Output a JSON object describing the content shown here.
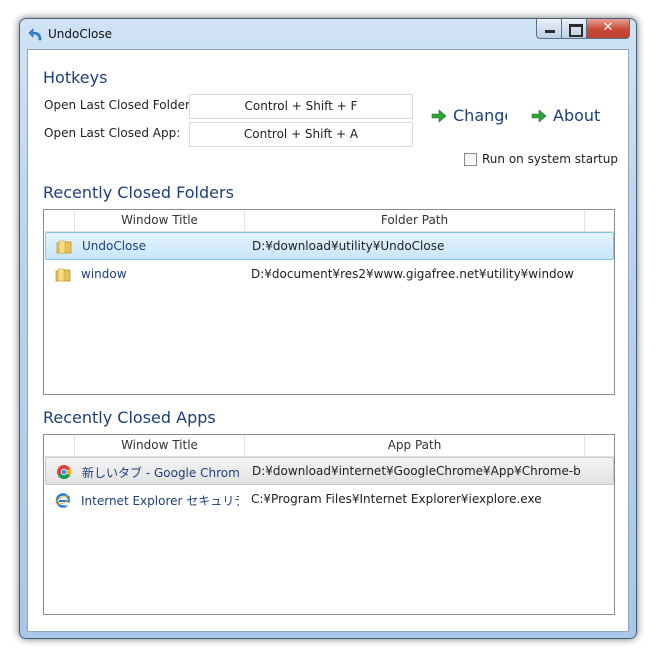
{
  "window": {
    "title": "UndoClose"
  },
  "hotkeys": {
    "heading": "Hotkeys",
    "folder_label": "Open Last Closed Folder:",
    "folder_value": "Control + Shift + F",
    "app_label": "Open Last Closed App:",
    "app_value": "Control + Shift + A",
    "change_label": "Change",
    "about_label": "About",
    "startup_label": "Run on system startup",
    "startup_checked": false
  },
  "folders": {
    "heading": "Recently Closed Folders",
    "columns": [
      "Window Title",
      "Folder Path"
    ],
    "rows": [
      {
        "icon": "folder-icon",
        "title": "UndoClose",
        "path": "D:¥download¥utility¥UndoClose",
        "selected": true
      },
      {
        "icon": "folder-icon",
        "title": "window",
        "path": "D:¥document¥res2¥www.gigafree.net¥utility¥window",
        "selected": false
      }
    ]
  },
  "apps": {
    "heading": "Recently Closed Apps",
    "columns": [
      "Window Title",
      "App Path"
    ],
    "rows": [
      {
        "icon": "chrome-icon",
        "title": "新しいタブ - Google Chrome",
        "path": "D:¥download¥internet¥GoogleChrome¥App¥Chrome-bin",
        "selected": true
      },
      {
        "icon": "ie-icon",
        "title": "Internet Explorer セキュリティ",
        "path": "C:¥Program Files¥Internet Explorer¥iexplore.exe",
        "selected": false
      }
    ]
  },
  "colors": {
    "accent": "#1c3f7a",
    "selection": "#c7e6fa",
    "arrow": "#2fa23a"
  }
}
